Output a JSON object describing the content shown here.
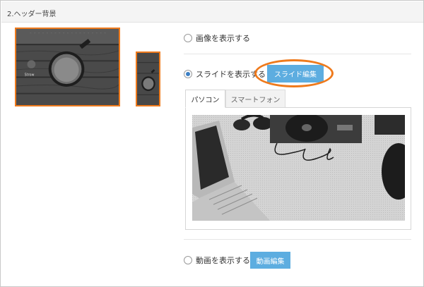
{
  "section": {
    "title": "2.ヘッダー背景"
  },
  "thumbnails": {
    "pc_stamp": "Strow"
  },
  "options": {
    "image": {
      "label": "画像を表示する",
      "selected": false
    },
    "slide": {
      "label": "スライドを表示する",
      "selected": true,
      "edit_button": "スライド編集"
    },
    "video": {
      "label": "動画を表示する",
      "selected": false,
      "edit_button": "動画編集"
    }
  },
  "tabs": [
    {
      "label": "パソコン",
      "active": true
    },
    {
      "label": "スマートフォン",
      "active": false
    }
  ],
  "colors": {
    "accent_orange": "#ef7a1c",
    "button_blue": "#5dade0",
    "radio_blue": "#3b7fc4"
  },
  "icons": {
    "radio": "radio-button-icon"
  }
}
